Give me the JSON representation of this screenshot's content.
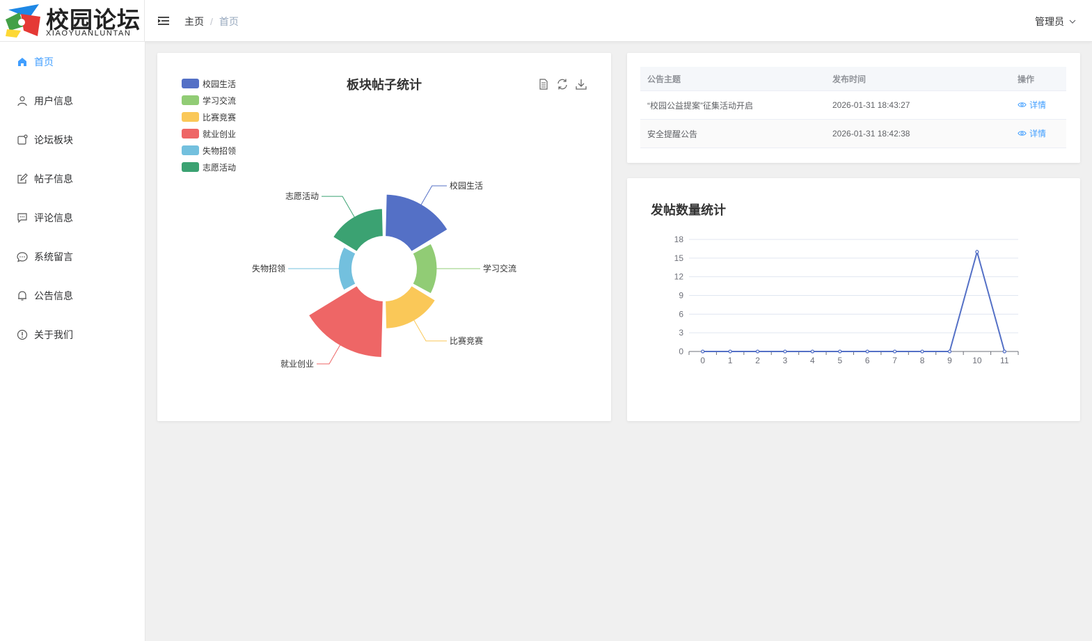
{
  "header": {
    "logo_title": "校园论坛",
    "logo_subtitle": "XIAOYUANLUNTAN",
    "breadcrumb_home": "主页",
    "breadcrumb_sep": "/",
    "breadcrumb_current": "首页",
    "user": "管理员"
  },
  "sidebar": {
    "items": [
      {
        "label": "首页",
        "icon": "home-icon",
        "active": true
      },
      {
        "label": "用户信息",
        "icon": "user-icon"
      },
      {
        "label": "论坛板块",
        "icon": "board-icon"
      },
      {
        "label": "帖子信息",
        "icon": "edit-icon"
      },
      {
        "label": "评论信息",
        "icon": "comment-icon"
      },
      {
        "label": "系统留言",
        "icon": "chat-icon"
      },
      {
        "label": "公告信息",
        "icon": "bell-icon"
      },
      {
        "label": "关于我们",
        "icon": "info-icon"
      }
    ]
  },
  "announcements": {
    "headers": [
      "公告主题",
      "发布时间",
      "操作"
    ],
    "rows": [
      {
        "title": "“校园公益提案”征集活动开启",
        "time": "2026-01-31 18:43:27",
        "action": "详情"
      },
      {
        "title": "安全提醒公告",
        "time": "2026-01-31 18:42:38",
        "action": "详情"
      }
    ]
  },
  "colors": {
    "accent": "#409eff",
    "series": [
      "#5470c6",
      "#91cc75",
      "#fac858",
      "#ee6666",
      "#73c0de",
      "#3ba272"
    ]
  },
  "chart_data": [
    {
      "type": "pie",
      "variant": "rose",
      "title": "板块帖子统计",
      "legend_position": "top-left",
      "categories": [
        "校园生活",
        "学习交流",
        "比赛竞赛",
        "就业创业",
        "失物招领",
        "志愿活动"
      ],
      "values": [
        5,
        2,
        3,
        7,
        1,
        3
      ]
    },
    {
      "type": "line",
      "title": "发帖数量统计",
      "x": [
        0,
        1,
        2,
        3,
        4,
        5,
        6,
        7,
        8,
        9,
        10,
        11
      ],
      "values": [
        0,
        0,
        0,
        0,
        0,
        0,
        0,
        0,
        0,
        0,
        16,
        0
      ],
      "ylim": [
        0,
        18
      ],
      "yticks": [
        0,
        3,
        6,
        9,
        12,
        15,
        18
      ],
      "grid": true
    }
  ]
}
